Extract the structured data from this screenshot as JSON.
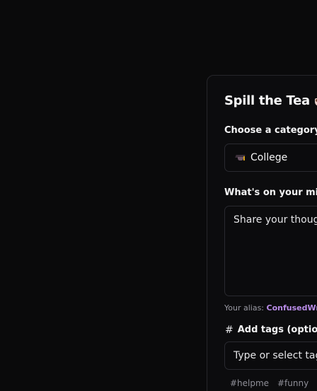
{
  "form": {
    "title": "Spill the Tea",
    "title_icon": "tea-cup-icon",
    "category_label": "Choose a category",
    "category_selected": "College",
    "category_icon": "graduation-cap-icon",
    "message_label": "What's on your mind",
    "message_placeholder": "Share your thought",
    "alias_prefix": "Your alias:",
    "alias_name": "ConfusedWrit",
    "tags_label": "Add tags (optiona",
    "tags_icon": "hash-icon",
    "tags_placeholder": "Type or select tags.",
    "suggested_tags": [
      "#helpme",
      "#funny"
    ]
  },
  "colors": {
    "background": "#0a0a0b",
    "card": "#0c0c0e",
    "border": "#2a2a30",
    "alias_accent": "#b98ce8",
    "muted_text": "#9a9aa3"
  }
}
